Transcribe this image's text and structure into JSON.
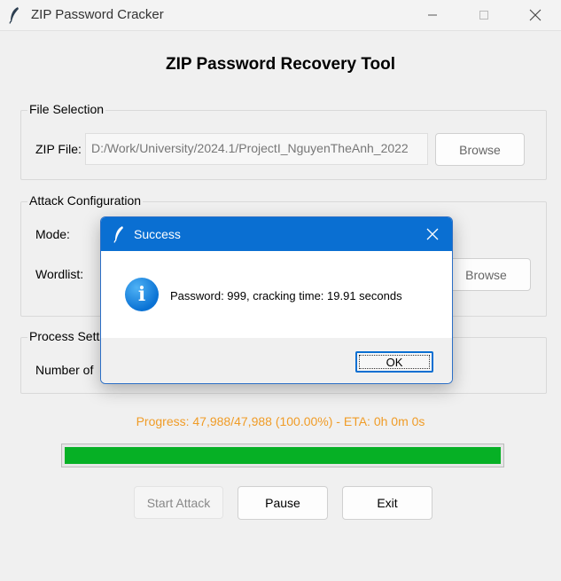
{
  "window": {
    "title": "ZIP Password Cracker"
  },
  "main": {
    "heading": "ZIP Password Recovery Tool",
    "file_selection": {
      "group_label": "File Selection",
      "zip_label": "ZIP File:",
      "zip_value": "D:/Work/University/2024.1/ProjectI_NguyenTheAnh_2022",
      "browse_label": "Browse"
    },
    "attack_configuration": {
      "group_label": "Attack Configuration",
      "mode_label": "Mode:",
      "wordlist_label": "Wordlist:",
      "browse_label": "Browse"
    },
    "process_settings": {
      "group_label": "Process Setti",
      "number_label": "Number of"
    },
    "progress": {
      "text": "Progress: 47,988/47,988 (100.00%) - ETA: 0h 0m 0s",
      "fraction": 1.0
    },
    "buttons": {
      "start": "Start Attack",
      "pause": "Pause",
      "exit": "Exit"
    }
  },
  "dialog": {
    "title": "Success",
    "icon": "info-icon",
    "message": "Password: 999, cracking time: 19.91 seconds",
    "ok_label": "OK"
  },
  "colors": {
    "progress_text": "#f09c27",
    "progress_fill": "#06b025",
    "dialog_titlebar": "#0a6fd2"
  }
}
